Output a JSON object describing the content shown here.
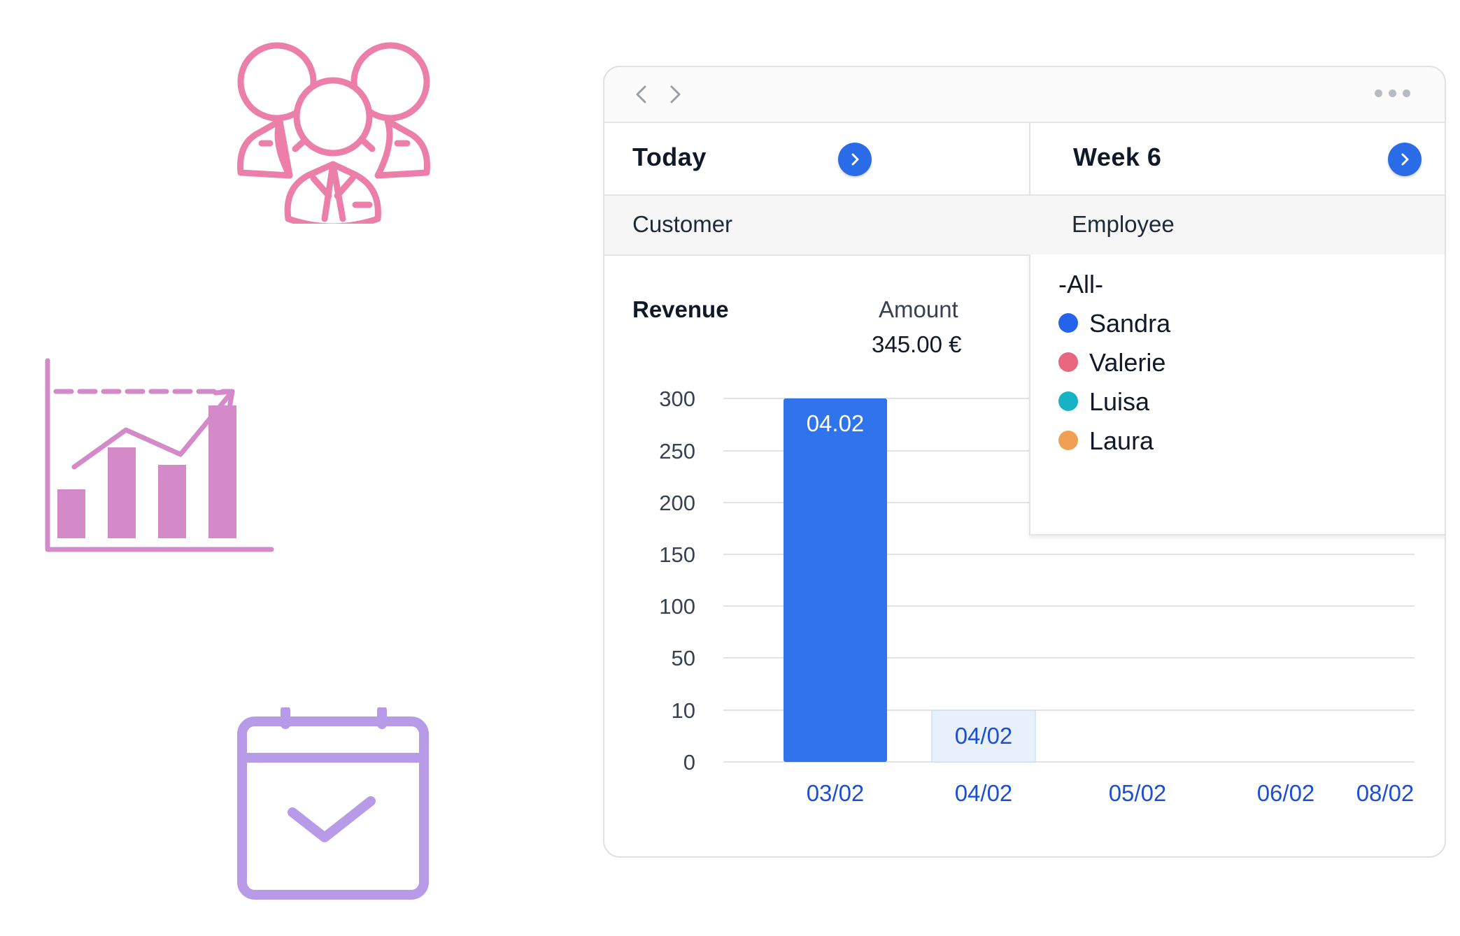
{
  "window": {
    "today_title": "Today",
    "week_title": "Week 6",
    "customer_label": "Customer",
    "employee_label": "Employee"
  },
  "revenue": {
    "title": "Revenue",
    "amount_label": "Amount",
    "amount_value": "345.00 €"
  },
  "employee_dropdown": {
    "options": [
      {
        "label": "-All-",
        "color": null
      },
      {
        "label": "Sandra",
        "color": "#2563eb"
      },
      {
        "label": "Valerie",
        "color": "#e8677e"
      },
      {
        "label": "Luisa",
        "color": "#17b3c4"
      },
      {
        "label": "Laura",
        "color": "#f0a055"
      }
    ]
  },
  "colors": {
    "accent": "#2a6ce8",
    "bar_primary": "#2f74ec",
    "bar_light": "#e8f1fb",
    "x_label": "#1d4fd6",
    "people_icon": "#ec7fa9",
    "growth_icon": "#d48ac8",
    "calendar_icon": "#b89be8"
  },
  "icons": [
    "people-group-icon",
    "growth-chart-icon",
    "calendar-check-icon"
  ],
  "chart_data": {
    "type": "bar",
    "yticks": [
      "300",
      "250",
      "200",
      "150",
      "100",
      "50",
      "10",
      "0"
    ],
    "categories": [
      "03/02",
      "04/02",
      "05/02",
      "06/02",
      "08/02"
    ],
    "values": [
      300,
      10,
      0,
      0,
      0
    ],
    "bar_labels": [
      "04.02",
      "04/02",
      "",
      "",
      ""
    ],
    "title": "",
    "xlabel": "",
    "ylabel": "",
    "grid": true
  }
}
